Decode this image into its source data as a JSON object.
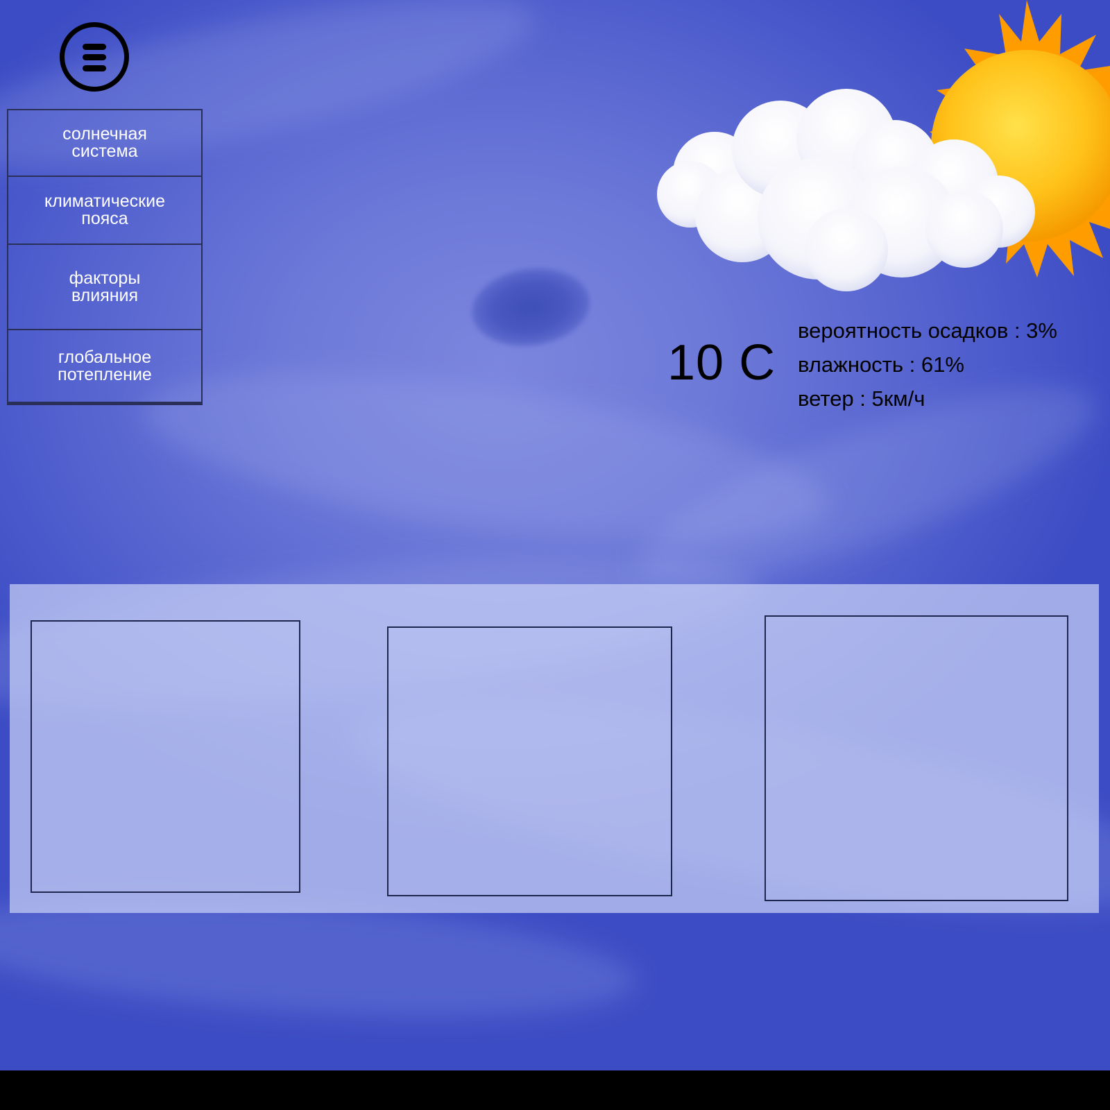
{
  "menu_button": {
    "icon": "hamburger-menu-icon"
  },
  "sidebar": {
    "items": [
      {
        "label": "солнечная\nсистема"
      },
      {
        "label": "климатические\nпояса"
      },
      {
        "label": "факторы\nвлияния"
      },
      {
        "label": "глобальное\nпотепление"
      }
    ]
  },
  "weather": {
    "icon": "partly-cloudy-sun-icon",
    "temperature": "10 С",
    "precipitation": "вероятность осадков : 3%",
    "humidity": "влажность : 61%",
    "wind": "ветер : 5км/ч"
  },
  "colors": {
    "background": "#5f6bd6",
    "panel": "#c8d0f5",
    "border": "#1e2650",
    "sun": "#f7a800"
  }
}
